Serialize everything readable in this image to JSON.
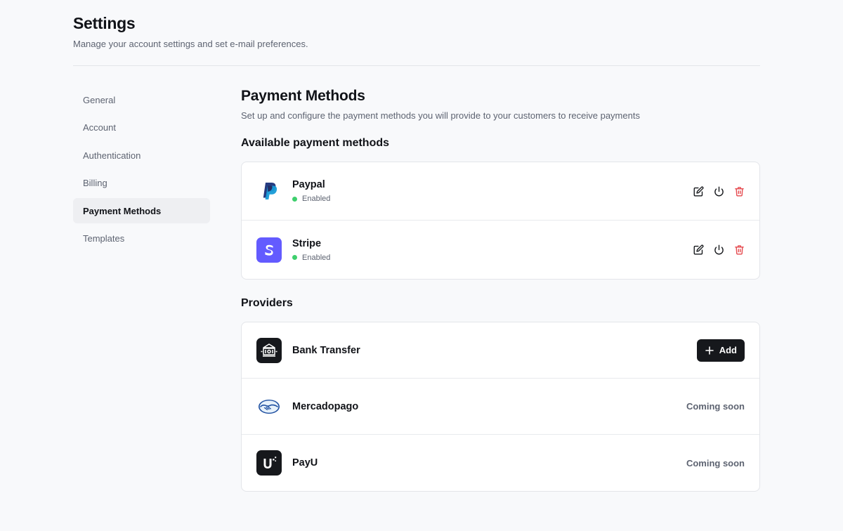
{
  "header": {
    "title": "Settings",
    "subtitle": "Manage your account settings and set e-mail preferences."
  },
  "sidebar": {
    "items": [
      {
        "label": "General"
      },
      {
        "label": "Account"
      },
      {
        "label": "Authentication"
      },
      {
        "label": "Billing"
      },
      {
        "label": "Payment Methods",
        "active": true
      },
      {
        "label": "Templates"
      }
    ]
  },
  "main": {
    "title": "Payment Methods",
    "description": "Set up and configure the payment methods you will provide to your customers to receive payments",
    "available": {
      "title": "Available payment methods",
      "methods": [
        {
          "name": "Paypal",
          "status": "Enabled",
          "icon": "paypal-logo"
        },
        {
          "name": "Stripe",
          "status": "Enabled",
          "icon": "stripe-logo"
        }
      ]
    },
    "providers": {
      "title": "Providers",
      "items": [
        {
          "name": "Bank Transfer",
          "action": "Add",
          "icon": "bank-logo"
        },
        {
          "name": "Mercadopago",
          "note": "Coming soon",
          "icon": "mercadopago-logo"
        },
        {
          "name": "PayU",
          "note": "Coming soon",
          "icon": "payu-logo"
        }
      ]
    }
  },
  "colors": {
    "accent": "#16181c",
    "status_enabled": "#3ecf6d",
    "danger": "#e5484d",
    "stripe": "#635bff",
    "paypal_dark": "#253b80",
    "paypal_light": "#179bd7"
  }
}
